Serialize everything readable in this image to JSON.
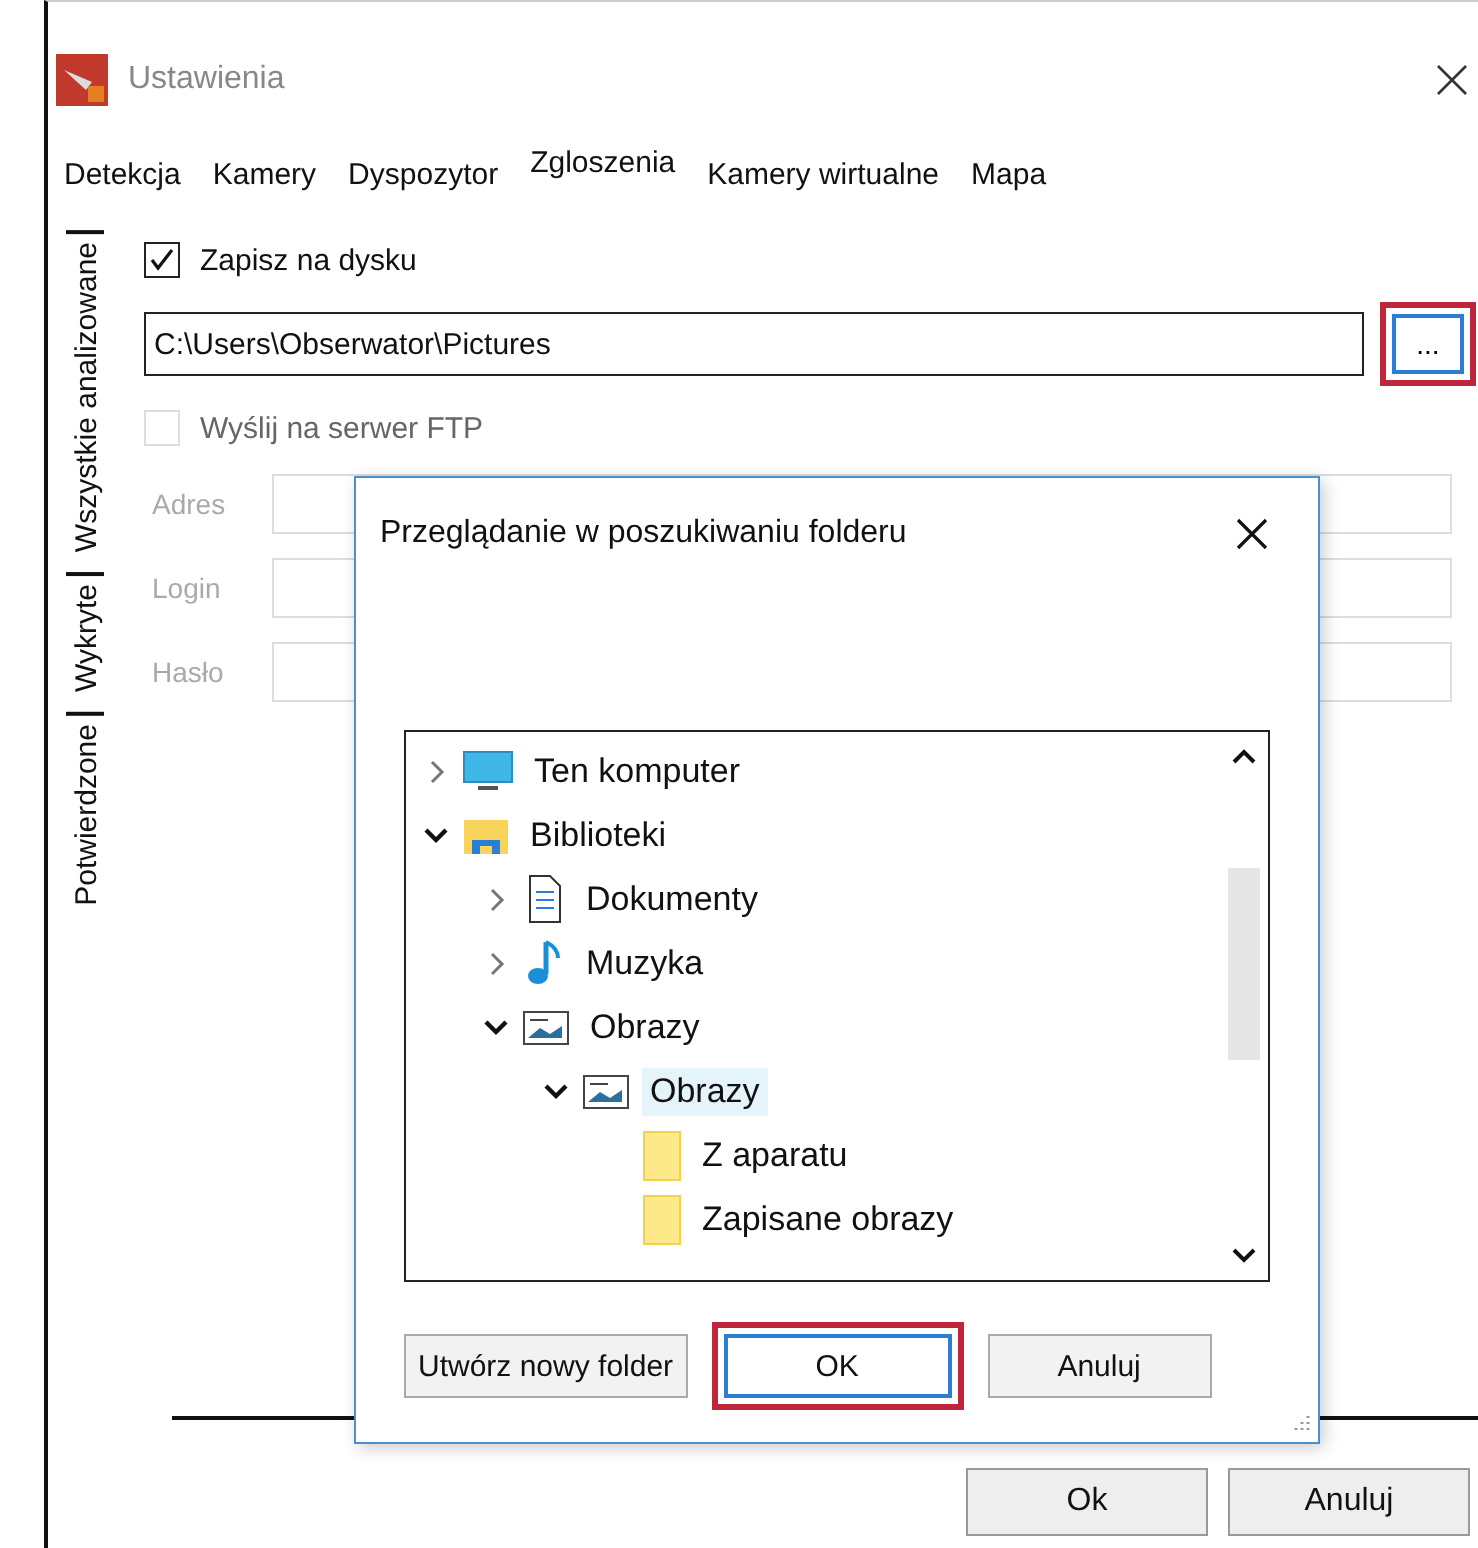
{
  "window": {
    "title": "Ustawienia"
  },
  "tabs": [
    {
      "label": "Detekcja",
      "selected": false
    },
    {
      "label": "Kamery",
      "selected": false
    },
    {
      "label": "Dyspozytor",
      "selected": false
    },
    {
      "label": "Zgloszenia",
      "selected": true
    },
    {
      "label": "Kamery wirtualne",
      "selected": false
    },
    {
      "label": "Mapa",
      "selected": false
    }
  ],
  "vertical_tabs": [
    {
      "label": "Wszystkie analizowane"
    },
    {
      "label": "Wykryte"
    },
    {
      "label": "Potwierdzone"
    }
  ],
  "save_to_disk": {
    "label": "Zapisz na dysku",
    "checked": true
  },
  "path_field": {
    "value": "C:\\Users\\Obserwator\\Pictures"
  },
  "browse_button": {
    "label": "..."
  },
  "ftp": {
    "label": "Wyślij na serwer FTP",
    "checked": false,
    "disabled": true
  },
  "ftp_fields": [
    {
      "label": "Adres"
    },
    {
      "label": "Login"
    },
    {
      "label": "Hasło"
    }
  ],
  "buttons": [
    "Ok",
    "Anuluj"
  ],
  "dialog": {
    "title": "Przeglądanie w poszukiwaniu folderu",
    "tree": [
      {
        "label": "Ten komputer",
        "kind": "computer",
        "expanded": false,
        "selected": false
      },
      {
        "label": "Biblioteki",
        "kind": "library",
        "expanded": true,
        "selected": false,
        "children": [
          {
            "label": "Dokumenty",
            "kind": "document",
            "expanded": false,
            "selected": false
          },
          {
            "label": "Muzyka",
            "kind": "music",
            "expanded": false,
            "selected": false
          },
          {
            "label": "Obrazy",
            "kind": "pictures",
            "expanded": true,
            "selected": false,
            "children": [
              {
                "label": "Obrazy",
                "kind": "pictures",
                "expanded": true,
                "selected": true,
                "children": [
                  {
                    "label": "Z aparatu",
                    "kind": "folder",
                    "selected": false
                  },
                  {
                    "label": "Zapisane obrazy",
                    "kind": "folder",
                    "selected": false
                  }
                ]
              }
            ]
          }
        ]
      }
    ],
    "buttons": [
      {
        "label": "Utwórz nowy folder",
        "highlighted": false
      },
      {
        "label": "OK",
        "highlighted": true
      },
      {
        "label": "Anuluj",
        "highlighted": false
      }
    ]
  }
}
